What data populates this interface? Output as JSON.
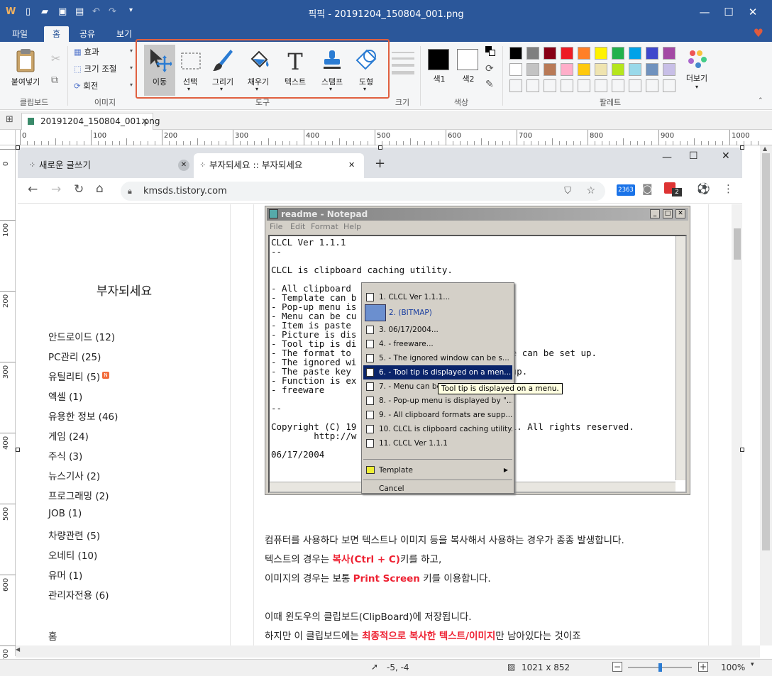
{
  "titlebar": {
    "title": "픽픽 - 20191204_150804_001.png"
  },
  "ribbon_tabs": [
    "파일",
    "홈",
    "공유",
    "보기"
  ],
  "ribbon": {
    "clipboard": {
      "paste": "붙여넣기",
      "group": "클립보드"
    },
    "image": {
      "effect": "효과",
      "resize": "크기 조절",
      "rotate": "회전",
      "group": "이미지"
    },
    "tools": {
      "move": "이동",
      "select": "선택",
      "draw": "그리기",
      "fill": "채우기",
      "text": "텍스트",
      "stamp": "스탬프",
      "shape": "도형",
      "group": "도구"
    },
    "size": {
      "group": "크기"
    },
    "color": {
      "color1": "색1",
      "color2": "색2",
      "group": "색상"
    },
    "palette": {
      "more": "더보기",
      "group": "팔레트",
      "row1": [
        "#000000",
        "#7f7f7f",
        "#880015",
        "#ed1c24",
        "#ff7f27",
        "#fff200",
        "#22b14c",
        "#00a2e8",
        "#3f48cc",
        "#a349a4"
      ],
      "row2": [
        "#ffffff",
        "#c3c3c3",
        "#b97a57",
        "#ffaec9",
        "#ffc90e",
        "#efe4b0",
        "#b5e61d",
        "#99d9ea",
        "#7092be",
        "#c8bfe7"
      ]
    }
  },
  "doc_tab": {
    "name": "20191204_150804_001.png"
  },
  "ruler": {
    "h": [
      "0",
      "100",
      "200",
      "300",
      "400",
      "500",
      "600",
      "700",
      "800",
      "900",
      "1000"
    ],
    "v": [
      "0",
      "100",
      "200",
      "300",
      "400",
      "500",
      "600",
      "700"
    ]
  },
  "browser": {
    "tab1": "새로운 글쓰기",
    "tab2": "부자되세요 :: 부자되세요",
    "url": "kmsds.tistory.com",
    "badge1": "2363",
    "badge2": "2"
  },
  "blog": {
    "name": "부자되세요",
    "categories": [
      "안드로이드 (12)",
      "PC관리 (25)",
      "유틸리티 (5)",
      "엑셀 (1)",
      "유용한 정보 (46)",
      "게임 (24)",
      "주식 (3)",
      "뉴스기사 (2)",
      "프로그래밍 (2)",
      "JOB (1)",
      "차량관련 (5)",
      "오네티 (10)",
      "유머 (1)",
      "관리자전용 (6)"
    ],
    "home": "홈",
    "new_badge": "N"
  },
  "notepad": {
    "title": "readme - Notepad",
    "menu": [
      "File",
      "Edit",
      "Format",
      "Help"
    ],
    "lines": [
      "CLCL Ver 1.1.1",
      "--",
      "",
      "CLCL is clipboard caching utility.",
      "",
      "- All clipboard",
      "- Template can b",
      "- Pop-up menu is",
      "- Menu can be cu",
      "- Item is paste",
      "- Picture is dis",
      "- Tool tip is di",
      "- The format to                              e can be set up.",
      "- The ignored wi",
      "- The paste key                              up.",
      "- Function is ex",
      "- freeware",
      "",
      "--",
      "",
      "Copyright (C) 19                             i. All rights reserved.",
      "        http://w",
      "",
      "06/17/2004"
    ]
  },
  "ctxmenu": {
    "items": [
      "1. CLCL Ver 1.1.1...",
      "2. (BITMAP)",
      "3. 06/17/2004...",
      "4. - freeware...",
      "5. - The ignored window can be s...",
      "6. - Tool tip is displayed on a men...",
      "7. - Menu can be",
      "8. - Pop-up menu is displayed by \"...",
      "9. - All clipboard formats are supp...",
      "10. CLCL is clipboard caching utility.",
      "11. CLCL Ver 1.1.1"
    ],
    "template": "Template",
    "cancel": "Cancel",
    "tooltip": "Tool tip is displayed on a menu."
  },
  "body": {
    "p1": "컴퓨터를 사용하다 보면 텍스트나 이미지 등을 복사해서 사용하는 경우가 종종 발생합니다.",
    "p2a": "텍스트의 경우는 ",
    "p2b": "복사(Ctrl + C)",
    "p2c": "키를 하고,",
    "p3a": "이미지의 경우는 보통 ",
    "p3b": "Print Screen",
    "p3c": " 키를 이용합니다.",
    "p4": "이때 윈도우의 클립보드(ClipBoard)에 저장됩니다.",
    "p5a": "하지만 이 클립보드에는 ",
    "p5b": "최종적으로 복사한 텍스트/이미지",
    "p5c": "만 남아있다는 것이죠"
  },
  "status": {
    "cursor": "-5, -4",
    "size": "1021 x 852",
    "zoom": "100%",
    "zoom_level": 0.5
  }
}
